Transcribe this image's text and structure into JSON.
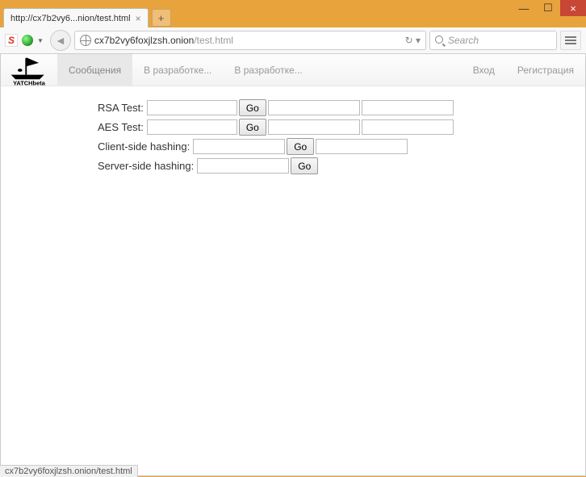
{
  "window": {
    "minimize": "—",
    "maximize": "☐",
    "close": "×"
  },
  "tab": {
    "title": "http://cx7b2vy6...nion/test.html",
    "close": "×",
    "new": "+"
  },
  "url": {
    "domain": "cx7b2vy6foxjlzsh.onion",
    "path": "/test.html",
    "reload": "↻ ▾"
  },
  "search": {
    "placeholder": "Search"
  },
  "nav": {
    "messages": "Сообщения",
    "dev1": "В разработке...",
    "dev2": "В разработке...",
    "login": "Вход",
    "register": "Регистрация"
  },
  "tests": {
    "rsa_label": "RSA Test:",
    "aes_label": "AES Test:",
    "client_hash_label": "Client-side hashing:",
    "server_hash_label": "Server-side hashing:",
    "go": "Go"
  },
  "status": "cx7b2vy6foxjlzsh.onion/test.html"
}
